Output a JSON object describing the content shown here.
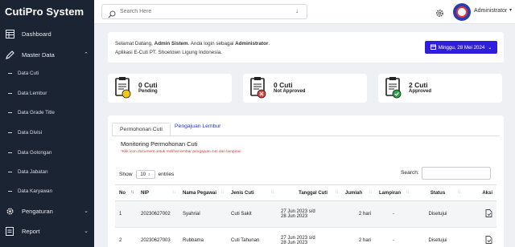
{
  "sidebar": {
    "brand": "CutiPro System",
    "items": [
      {
        "label": "Dashboard",
        "icon": "dashboard-icon"
      },
      {
        "label": "Master Data",
        "icon": "pencil-icon",
        "expanded": true
      },
      {
        "label": "Pengaturan",
        "icon": "gear-icon"
      },
      {
        "label": "Report",
        "icon": "report-icon"
      }
    ],
    "sub_items": [
      "Data Cuti",
      "Data Lembur",
      "Data Grade Title",
      "Data Divisi",
      "Data Golongan",
      "Data Jabatan",
      "Data Karyawan"
    ]
  },
  "topbar": {
    "search_placeholder": "Search Here",
    "user": "Administrator"
  },
  "welcome": {
    "prefix": "Selamat Datang, ",
    "name": "Admin Sistem",
    "middle": ". Anda login sebagai ",
    "role": "Administrator",
    "end": ".",
    "line2": "Aplikasi E-Cuti PT. Shoetown Ligung Indonesia.",
    "date_button": "Minggu, 28 Mei 2024"
  },
  "stats": [
    {
      "count": "0 Cuti",
      "label": "Pending",
      "badge_color": "#f5c518"
    },
    {
      "count": "0 Cuti",
      "label": "Not Approved",
      "badge_color": "#e2423b"
    },
    {
      "count": "2 Cuti",
      "label": "Approved",
      "badge_color": "#28a745"
    }
  ],
  "tabs": [
    "Permohonan Cuti",
    "Pengajuan Lembur"
  ],
  "panel": {
    "title": "Monitoring Permohonan Cuti",
    "note": "*Klik icon document untuk melihat lembar pengajuan cuti dan lampiran",
    "show_label": "Show",
    "show_value": "10",
    "entries_label": "entries",
    "search_label": "Search:"
  },
  "table": {
    "columns": [
      "No",
      "NIP",
      "Nama Pegawai",
      "Jenis Cuti",
      "Tanggal Cuti",
      "Jumlah",
      "Lampiran",
      "Status",
      "Aksi"
    ],
    "rows": [
      {
        "no": "1",
        "nip": "20230627002",
        "nama": "Syahrial",
        "jenis": "Cuti Sakit",
        "tgl1": "27 Jun 2023 s/d",
        "tgl2": "28 Jun 2023",
        "jumlah": "2 hari",
        "lampiran": "-",
        "status": "Disetujui"
      },
      {
        "no": "2",
        "nip": "20230627003",
        "nama": "Rubbama",
        "jenis": "Cuti Tahunan",
        "tgl1": "27 Jun 2023 s/d",
        "tgl2": "28 Jun 2023",
        "jumlah": "2 hari",
        "lampiran": "-",
        "status": "Disetujui"
      }
    ]
  },
  "colors": {
    "sidebar_bg": "#1b2432",
    "accent": "#2f1fdc",
    "link": "#1d33d8",
    "note_red": "#e23030"
  }
}
